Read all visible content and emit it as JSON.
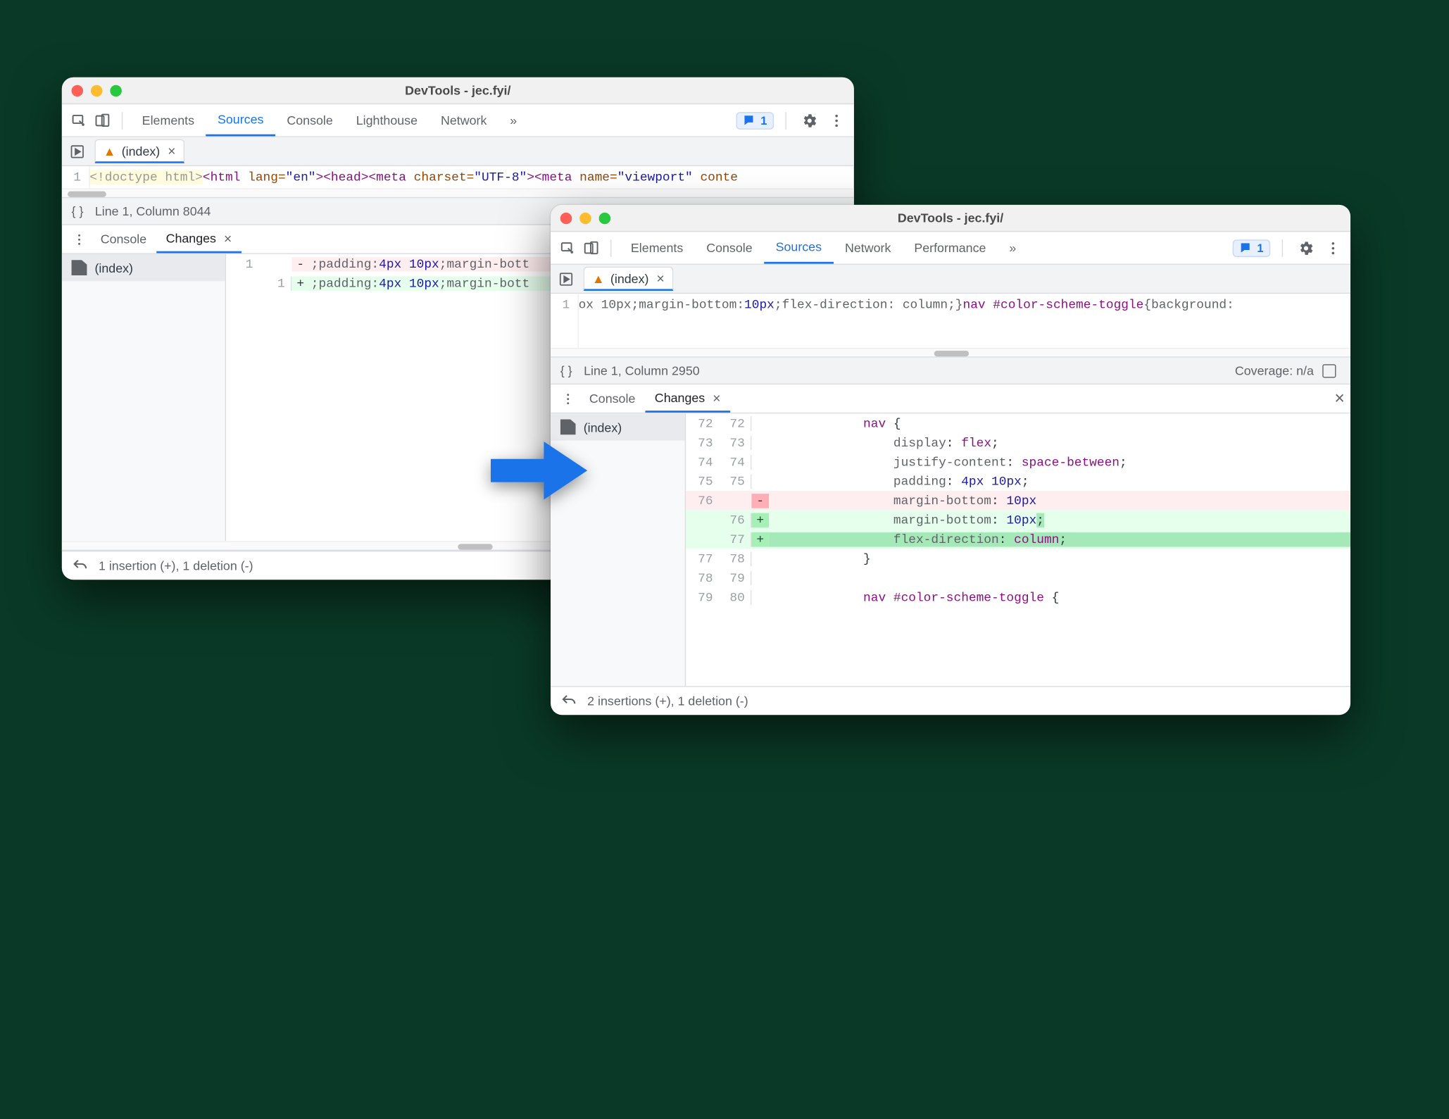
{
  "window1": {
    "title": "DevTools - jec.fyi/",
    "tabs": [
      "Elements",
      "Sources",
      "Console",
      "Lighthouse",
      "Network"
    ],
    "active_tab": "Sources",
    "more_tabs_glyph": "»",
    "issue_count": "1",
    "file_tab": "(index)",
    "code_line_num": "1",
    "code_tokens": {
      "doctype": "<!doctype html>",
      "html_open": "<html ",
      "lang_attr": "lang=",
      "lang_val": "\"en\"",
      "close": ">",
      "head": "<head>",
      "meta1": "<meta ",
      "charset_attr": "charset=",
      "charset_val": "\"UTF-8\"",
      "meta2": "<meta ",
      "name_attr": "name=",
      "name_val": "\"viewport\"",
      "cont": " conte"
    },
    "status_line": "Line 1, Column 8044",
    "drawer_tabs": [
      "Console",
      "Changes"
    ],
    "drawer_active": "Changes",
    "file_item": "(index)",
    "diff": {
      "del": {
        "ln": "1",
        "sign": "-",
        "text": ";padding:4px 10px;margin-bott"
      },
      "add": {
        "ln": "1",
        "sign": "+",
        "text": ";padding:4px 10px;margin-bott"
      }
    },
    "footer": "1 insertion (+), 1 deletion (-)"
  },
  "window2": {
    "title": "DevTools - jec.fyi/",
    "tabs": [
      "Elements",
      "Console",
      "Sources",
      "Network",
      "Performance"
    ],
    "active_tab": "Sources",
    "more_tabs_glyph": "»",
    "issue_count": "1",
    "file_tab": "(index)",
    "code_line_num": "1",
    "code_text_prefix": "ox 10px;margin-bottom:",
    "code_text_10px": "10px",
    "code_text_mid": ";flex-direction: column;}",
    "code_text_sel": "nav #color-scheme-toggle",
    "code_text_suffix": "{background:",
    "status_line": "Line 1, Column 2950",
    "coverage": "Coverage: n/a",
    "drawer_tabs": [
      "Console",
      "Changes"
    ],
    "drawer_active": "Changes",
    "file_item": "(index)",
    "diff_rows": [
      {
        "a": "72",
        "b": "72",
        "sign": "",
        "cls": "",
        "tokens": [
          [
            "sel",
            "nav"
          ],
          [
            "txt",
            " {"
          ]
        ]
      },
      {
        "a": "73",
        "b": "73",
        "sign": "",
        "cls": "",
        "tokens": [
          [
            "prop",
            "    display"
          ],
          [
            "txt",
            ": "
          ],
          [
            "sel",
            "flex"
          ],
          [
            "txt",
            ";"
          ]
        ]
      },
      {
        "a": "74",
        "b": "74",
        "sign": "",
        "cls": "",
        "tokens": [
          [
            "prop",
            "    justify-content"
          ],
          [
            "txt",
            ": "
          ],
          [
            "sel",
            "space-between"
          ],
          [
            "txt",
            ";"
          ]
        ]
      },
      {
        "a": "75",
        "b": "75",
        "sign": "",
        "cls": "",
        "tokens": [
          [
            "prop",
            "    padding"
          ],
          [
            "txt",
            ": "
          ],
          [
            "num",
            "4px 10px"
          ],
          [
            "txt",
            ";"
          ]
        ]
      },
      {
        "a": "76",
        "b": "",
        "sign": "-",
        "cls": "del",
        "tokens": [
          [
            "prop",
            "    margin-bottom"
          ],
          [
            "txt",
            ": "
          ],
          [
            "num",
            "10px"
          ]
        ],
        "strong_tail": ""
      },
      {
        "a": "",
        "b": "76",
        "sign": "+",
        "cls": "add",
        "tokens": [
          [
            "prop",
            "    margin-bottom"
          ],
          [
            "txt",
            ": "
          ],
          [
            "num",
            "10px"
          ]
        ],
        "strong_tail": ";"
      },
      {
        "a": "",
        "b": "77",
        "sign": "+",
        "cls": "add",
        "strong_full": true,
        "tokens": [
          [
            "prop",
            "    flex-direction"
          ],
          [
            "txt",
            ": "
          ],
          [
            "sel",
            "column"
          ],
          [
            "txt",
            ";"
          ]
        ]
      },
      {
        "a": "77",
        "b": "78",
        "sign": "",
        "cls": "",
        "tokens": [
          [
            "txt",
            "}"
          ]
        ]
      },
      {
        "a": "78",
        "b": "79",
        "sign": "",
        "cls": "",
        "tokens": [
          [
            "txt",
            ""
          ]
        ]
      },
      {
        "a": "79",
        "b": "80",
        "sign": "",
        "cls": "",
        "tokens": [
          [
            "sel",
            "nav #color-scheme-toggle"
          ],
          [
            "txt",
            " {"
          ]
        ]
      }
    ],
    "footer": "2 insertions (+), 1 deletion (-)"
  }
}
